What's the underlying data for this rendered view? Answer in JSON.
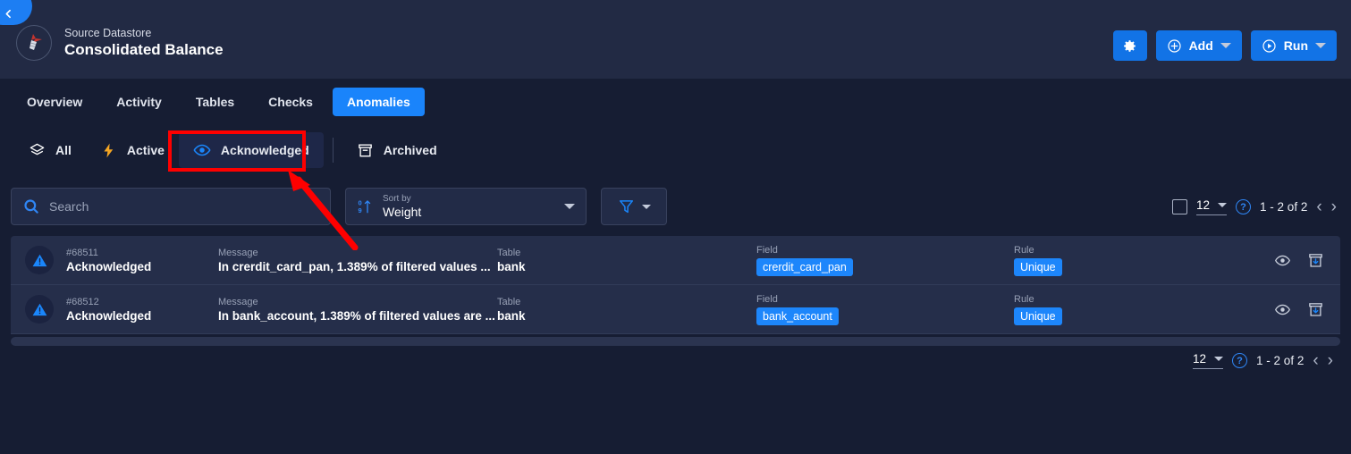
{
  "header": {
    "back_icon": "chevron-left-icon",
    "avatar_icon": "datastore-logo-icon",
    "subtitle": "Source Datastore",
    "title": "Consolidated Balance",
    "settings_icon": "gear-icon",
    "add_label": "Add",
    "add_icon": "plus-circle-icon",
    "run_label": "Run",
    "run_icon": "play-circle-icon",
    "chevron_icon": "chevron-down-icon"
  },
  "tabs": [
    {
      "label": "Overview",
      "active": false
    },
    {
      "label": "Activity",
      "active": false
    },
    {
      "label": "Tables",
      "active": false
    },
    {
      "label": "Checks",
      "active": false
    },
    {
      "label": "Anomalies",
      "active": true
    }
  ],
  "filters": [
    {
      "label": "All",
      "icon": "layers-icon",
      "selected": false
    },
    {
      "label": "Active",
      "icon": "lightning-bolt-icon",
      "selected": false
    },
    {
      "label": "Acknowledged",
      "icon": "eye-icon",
      "selected": true
    },
    {
      "label": "Archived",
      "icon": "archive-icon",
      "selected": false
    }
  ],
  "toolbar": {
    "search_placeholder": "Search",
    "search_value": "",
    "search_icon": "search-icon",
    "sort_caption": "Sort by",
    "sort_value": "Weight",
    "sort_icon": "sort-ascending-icon",
    "filter_icon": "funnel-icon"
  },
  "pagination": {
    "page_size": "12",
    "help_label": "?",
    "range": "1 - 2 of 2",
    "prev_icon": "chevron-left-icon",
    "next_icon": "chevron-right-icon"
  },
  "table": {
    "captions": {
      "message": "Message",
      "table": "Table",
      "field": "Field",
      "rule": "Rule"
    },
    "row_actions": {
      "view_icon": "eye-icon",
      "archive_icon": "archive-down-icon"
    },
    "rows": [
      {
        "status_icon": "warning-triangle-icon",
        "id": "#68511",
        "status": "Acknowledged",
        "message": "In crerdit_card_pan, 1.389% of filtered values ...",
        "table": "bank",
        "field": "crerdit_card_pan",
        "rule": "Unique"
      },
      {
        "status_icon": "warning-triangle-icon",
        "id": "#68512",
        "status": "Acknowledged",
        "message": "In bank_account, 1.389% of filtered values are ...",
        "table": "bank",
        "field": "bank_account",
        "rule": "Unique"
      }
    ]
  },
  "annotation": {
    "color": "#fe0000",
    "target": "Acknowledged"
  }
}
